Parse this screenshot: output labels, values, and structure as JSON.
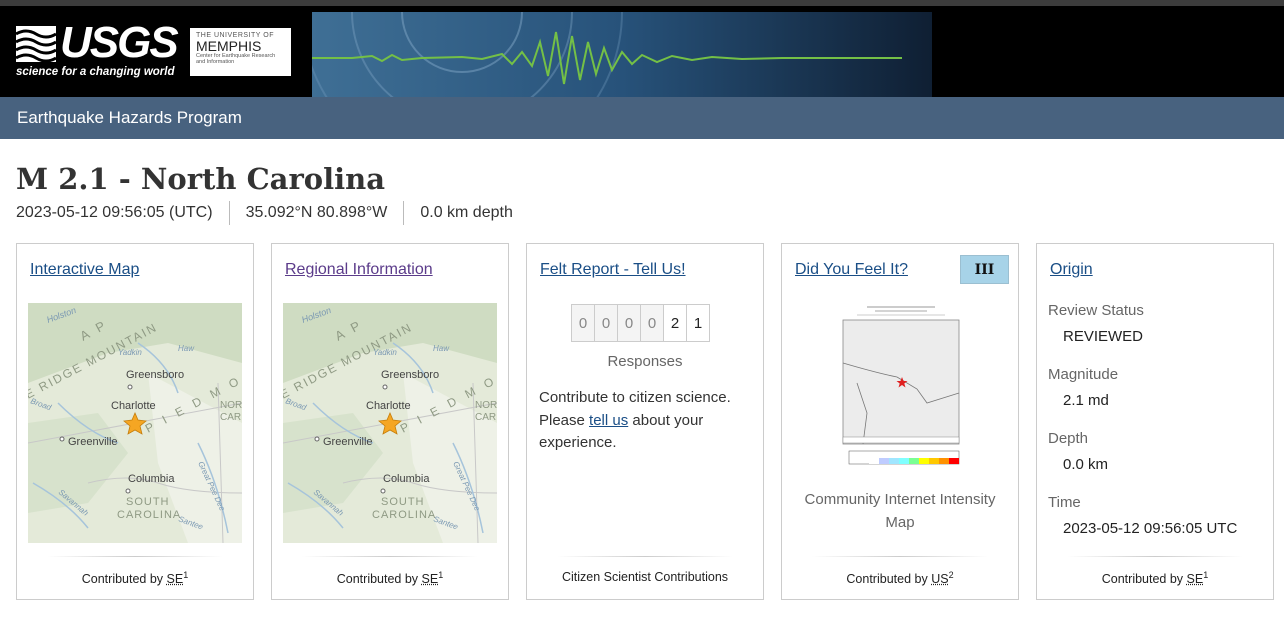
{
  "header": {
    "logo_text": "USGS",
    "logo_tagline": "science for a changing world",
    "partner_line1": "THE UNIVERSITY OF",
    "partner_line2": "MEMPHIS",
    "partner_line3": "Center for Earthquake Research and Information"
  },
  "nav": {
    "program": "Earthquake Hazards Program"
  },
  "event": {
    "title": "M 2.1 - North Carolina",
    "time": "2023-05-12 09:56:05 (UTC)",
    "location": "35.092°N 80.898°W",
    "depth": "0.0 km depth"
  },
  "map_labels": {
    "holston": "Holston",
    "appalachian": "A P",
    "blue_ridge": "E RIDGE MOUNTAIN",
    "yadkin": "Yadkin",
    "haw": "Haw",
    "greensboro": "Greensboro",
    "piedmont_pm": "P I E D M O",
    "charlotte": "Charlotte",
    "greenville": "Greenville",
    "broad": "Broad",
    "nor": "NOR",
    "car": "CAR",
    "columbia": "Columbia",
    "south": "SOUTH",
    "carolina": "CAROLINA",
    "savannah": "Savannah",
    "santee": "Santee",
    "great_pee_dee": "Great Pee Dee"
  },
  "cards": {
    "interactive_map": {
      "title": "Interactive Map",
      "footer_prefix": "Contributed by",
      "footer_source": "SE",
      "footer_sup": "1"
    },
    "regional": {
      "title": "Regional Information",
      "footer_prefix": "Contributed by",
      "footer_source": "SE",
      "footer_sup": "1"
    },
    "felt": {
      "title": "Felt Report - Tell Us!",
      "digits": [
        "0",
        "0",
        "0",
        "0",
        "2",
        "1"
      ],
      "responses_label": "Responses",
      "text_line1": "Contribute to citizen science.",
      "text_please": "Please",
      "text_link": "tell us",
      "text_rest": "about your experience.",
      "footer": "Citizen Scientist Contributions"
    },
    "dyfi": {
      "title": "Did You Feel It?",
      "mmi": "III",
      "caption": "Community Internet Intensity Map",
      "footer_prefix": "Contributed by",
      "footer_source": "US",
      "footer_sup": "2"
    },
    "origin": {
      "title": "Origin",
      "review_status_label": "Review Status",
      "review_status": "REVIEWED",
      "magnitude_label": "Magnitude",
      "magnitude": "2.1 md",
      "depth_label": "Depth",
      "depth": "0.0 km",
      "time_label": "Time",
      "time": "2023-05-12 09:56:05 UTC",
      "footer_prefix": "Contributed by",
      "footer_source": "SE",
      "footer_sup": "1"
    }
  },
  "colors": {
    "nav_bar": "#48627f",
    "link": "#1a4e86",
    "mmi_badge": "#a7d3e8",
    "epicenter_star": "#f5a623"
  }
}
